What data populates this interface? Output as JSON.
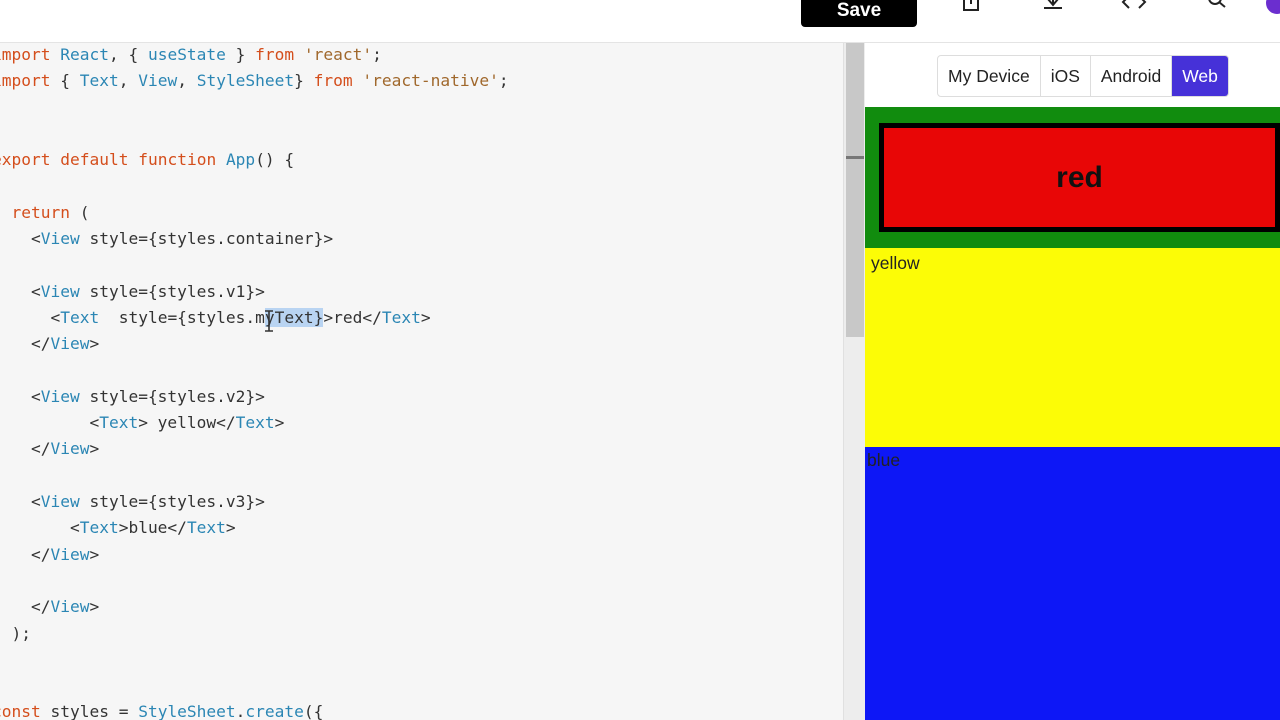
{
  "toolbar": {
    "save_label": "Save",
    "icons": [
      "share-icon",
      "download-icon",
      "code-icon",
      "search-icon"
    ]
  },
  "editor": {
    "lines": [
      "import React, { useState } from 'react';",
      "import { Text, View, StyleSheet} from 'react-native';",
      "",
      "",
      "export default function App() {",
      "",
      "  return (",
      "    <View style={styles.container}>",
      "",
      "    <View style={styles.v1}>",
      "      <Text  style={styles.myText}>red</Text>",
      "    </View>",
      "",
      "    <View style={styles.v2}>",
      "          <Text> yellow</Text>",
      "    </View>",
      "",
      "    <View style={styles.v3}>",
      "        <Text>blue</Text>",
      "    </View>",
      "",
      "    </View>",
      "  );",
      "}",
      "",
      "const styles = StyleSheet.create({"
    ],
    "selected_text": "yText}"
  },
  "preview": {
    "tabs": [
      {
        "label": "My Device",
        "active": false
      },
      {
        "label": "iOS",
        "active": false
      },
      {
        "label": "Android",
        "active": false
      },
      {
        "label": "Web",
        "active": true
      }
    ],
    "red_text": "red",
    "yellow_text": "yellow",
    "blue_text": "blue",
    "colors": {
      "green": "#118c0e",
      "red": "#e80606",
      "yellow": "#fcfc06",
      "blue": "#0d17f6",
      "active_tab": "#4631d8"
    }
  }
}
